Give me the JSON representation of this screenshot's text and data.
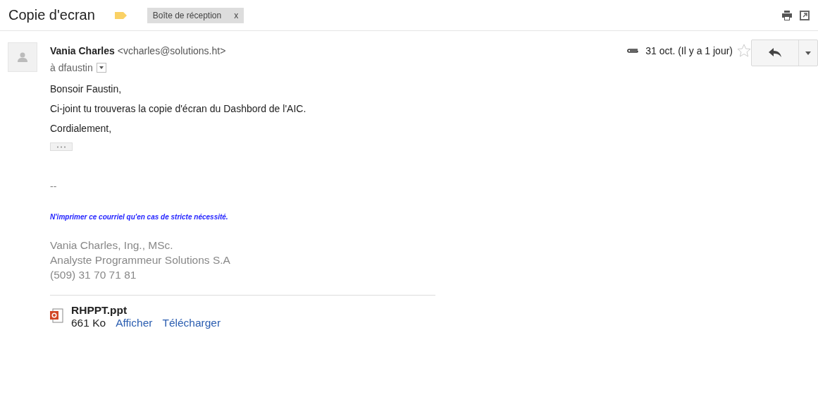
{
  "subject": "Copie d'ecran",
  "label_tag": {
    "color": "#fad165"
  },
  "labels": [
    {
      "text": "Boîte de réception",
      "remove": "x"
    }
  ],
  "message": {
    "sender_name": "Vania Charles",
    "sender_email": "<vcharles@solutions.ht>",
    "recipient": "à dfaustin",
    "has_attachment": true,
    "date": "31 oct. (Il y a 1 jour)",
    "starred": false,
    "body": [
      "Bonsoir Faustin,",
      "Ci-joint tu trouveras la copie d'écran du Dashbord de l'AIC.",
      "Cordialement,"
    ],
    "signature": {
      "separator": "--",
      "notice": "N'imprimer ce courriel qu'en cas de stricte nécessité.",
      "lines": [
        "Vania Charles, Ing., MSc.",
        "Analyste Programmeur Solutions S.A",
        "(509) 31 70 71 81"
      ]
    },
    "attachments": [
      {
        "name": "RHPPT.ppt",
        "size": "661 Ko",
        "actions": [
          "Afficher",
          "Télécharger"
        ]
      }
    ]
  }
}
